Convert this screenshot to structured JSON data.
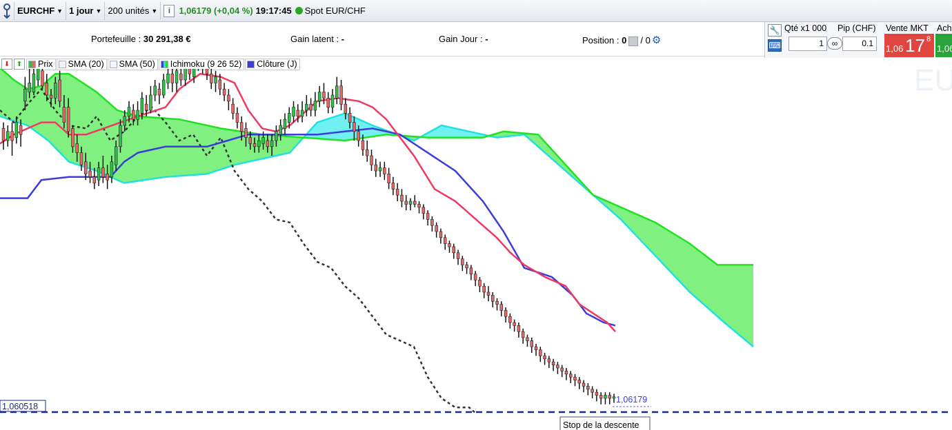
{
  "toolbar": {
    "symbol": "EURCHF",
    "timeframe": "1 jour",
    "units": "200 unités",
    "info_icon": "i",
    "price_change": "1,06179 (+0,04 %)",
    "time": "19:17:45",
    "instrument": "Spot EUR/CHF"
  },
  "infobar": {
    "portfolio_label": "Portefeuille :",
    "portfolio_value": "30 291,38 €",
    "unrealized_label": "Gain latent :",
    "unrealized_value": "-",
    "daily_label": "Gain Jour :",
    "daily_value": "-",
    "position_label": "Position :",
    "position_value": "0",
    "position_sep": "/ 0"
  },
  "trade_panel": {
    "qty_label": "Qté x1 000",
    "pip_label": "Pip (CHF)",
    "qty_value": "1",
    "pip_value": "0.1",
    "sell_label": "Vente MKT",
    "buy_label": "Ach",
    "sell_small": "1,06",
    "sell_big": "17",
    "sell_sup": "8",
    "buy_small": "1,06"
  },
  "legend": {
    "prix": "Prix",
    "sma20": "SMA (20)",
    "sma50": "SMA (50)",
    "ichimoku": "Ichimoku (9 26 52)",
    "cloture": "Clôture (J)"
  },
  "watermark": "EU",
  "colors": {
    "up_candle": "#2fc24a",
    "down_candle": "#e06a6a",
    "tenkan": "#ee3a63",
    "kijun": "#3c3cdc",
    "senkou_a": "#22e022",
    "senkou_b": "#22e0e0",
    "cloud_bull": "#80f080",
    "cloud_bear": "#70f0f0",
    "chikou": "#333333",
    "stop_line": "#1a2a8c"
  },
  "chart_data": {
    "type": "candlestick-ichimoku",
    "last_price": "1,06179",
    "level_price": "1,060518",
    "annotation": "Stop de la descente",
    "candles": [
      [
        0.94,
        0.9,
        0.96,
        0.87
      ],
      [
        0.9,
        0.93,
        0.95,
        0.88
      ],
      [
        0.93,
        0.9,
        0.96,
        0.85
      ],
      [
        0.91,
        0.96,
        0.98,
        0.89
      ],
      [
        0.95,
        0.92,
        0.97,
        0.88
      ],
      [
        1.03,
        1.07,
        1.11,
        1.0
      ],
      [
        1.06,
        1.09,
        1.14,
        1.04
      ],
      [
        1.06,
        1.12,
        1.15,
        1.05
      ],
      [
        1.1,
        1.14,
        1.18,
        1.08
      ],
      [
        1.13,
        1.08,
        1.16,
        1.07
      ],
      [
        1.09,
        1.05,
        1.12,
        1.03
      ],
      [
        1.05,
        1.04,
        1.07,
        1.01
      ],
      [
        1.04,
        1.09,
        1.11,
        1.02
      ],
      [
        1.1,
        1.03,
        1.13,
        1.01
      ],
      [
        1.01,
        0.96,
        1.05,
        0.94
      ],
      [
        1.01,
        0.93,
        1.04,
        0.91
      ],
      [
        0.94,
        0.88,
        0.95,
        0.86
      ],
      [
        0.89,
        0.86,
        0.92,
        0.83
      ],
      [
        0.86,
        0.82,
        0.88,
        0.8
      ],
      [
        0.83,
        0.79,
        0.86,
        0.77
      ],
      [
        0.8,
        0.78,
        0.83,
        0.76
      ],
      [
        0.78,
        0.76,
        0.81,
        0.74
      ],
      [
        0.77,
        0.81,
        0.83,
        0.75
      ],
      [
        0.81,
        0.78,
        0.85,
        0.76
      ],
      [
        0.79,
        0.77,
        0.82,
        0.74
      ],
      [
        0.78,
        0.83,
        0.85,
        0.76
      ],
      [
        0.82,
        0.88,
        0.9,
        0.8
      ],
      [
        0.88,
        0.95,
        0.97,
        0.86
      ],
      [
        0.95,
        0.98,
        1.0,
        0.93
      ],
      [
        0.98,
        1.01,
        1.03,
        0.96
      ],
      [
        1.0,
        0.97,
        1.02,
        0.95
      ],
      [
        0.97,
        1.0,
        1.03,
        0.95
      ],
      [
        0.99,
        1.04,
        1.06,
        0.97
      ],
      [
        1.02,
        1.0,
        1.05,
        0.98
      ],
      [
        1.0,
        1.05,
        1.08,
        0.99
      ],
      [
        1.05,
        1.08,
        1.1,
        1.03
      ],
      [
        1.07,
        1.05,
        1.09,
        1.02
      ],
      [
        1.05,
        1.1,
        1.12,
        1.04
      ],
      [
        1.09,
        1.12,
        1.15,
        1.07
      ],
      [
        1.12,
        1.09,
        1.14,
        1.06
      ],
      [
        1.09,
        1.13,
        1.15,
        1.06
      ],
      [
        1.12,
        1.1,
        1.14,
        1.08
      ],
      [
        1.1,
        1.15,
        1.17,
        1.08
      ],
      [
        1.14,
        1.12,
        1.16,
        1.1
      ],
      [
        1.11,
        1.16,
        1.18,
        1.09
      ],
      [
        1.15,
        1.18,
        1.2,
        1.13
      ],
      [
        1.17,
        1.14,
        1.19,
        1.12
      ],
      [
        1.14,
        1.12,
        1.16,
        1.1
      ],
      [
        1.12,
        1.09,
        1.14,
        1.07
      ],
      [
        1.09,
        1.11,
        1.13,
        1.06
      ],
      [
        1.1,
        1.07,
        1.12,
        1.05
      ],
      [
        1.07,
        1.05,
        1.09,
        1.03
      ],
      [
        1.05,
        1.03,
        1.07,
        1.0
      ],
      [
        1.02,
        0.99,
        1.04,
        0.97
      ],
      [
        0.99,
        0.96,
        1.01,
        0.94
      ],
      [
        0.96,
        0.93,
        0.98,
        0.9
      ],
      [
        0.94,
        0.91,
        0.96,
        0.88
      ],
      [
        0.91,
        0.89,
        0.93,
        0.87
      ],
      [
        0.89,
        0.88,
        0.91,
        0.86
      ],
      [
        0.88,
        0.9,
        0.92,
        0.86
      ],
      [
        0.89,
        0.91,
        0.93,
        0.87
      ],
      [
        0.9,
        0.88,
        0.92,
        0.86
      ],
      [
        0.88,
        0.9,
        0.92,
        0.85
      ],
      [
        0.9,
        0.93,
        0.95,
        0.88
      ],
      [
        0.92,
        0.95,
        0.97,
        0.9
      ],
      [
        0.94,
        0.97,
        0.99,
        0.92
      ],
      [
        0.96,
        0.99,
        1.01,
        0.94
      ],
      [
        0.98,
        1.01,
        1.03,
        0.96
      ],
      [
        1.0,
        0.98,
        1.02,
        0.96
      ],
      [
        0.98,
        1.0,
        1.03,
        0.96
      ],
      [
        1.0,
        1.02,
        1.05,
        0.98
      ],
      [
        1.02,
        1.0,
        1.04,
        0.98
      ],
      [
        1.0,
        1.03,
        1.06,
        0.98
      ],
      [
        1.03,
        1.06,
        1.08,
        1.01
      ],
      [
        1.06,
        1.04,
        1.09,
        1.02
      ],
      [
        1.04,
        1.01,
        1.06,
        0.99
      ],
      [
        1.01,
        1.05,
        1.07,
        0.99
      ],
      [
        1.04,
        1.08,
        1.11,
        1.02
      ],
      [
        1.08,
        1.02,
        1.1,
        1.0
      ],
      [
        1.02,
        0.99,
        1.04,
        0.97
      ],
      [
        0.99,
        0.96,
        1.01,
        0.94
      ],
      [
        0.96,
        0.93,
        0.98,
        0.9
      ],
      [
        0.93,
        0.9,
        0.95,
        0.88
      ],
      [
        0.9,
        0.87,
        0.92,
        0.85
      ],
      [
        0.87,
        0.85,
        0.9,
        0.83
      ],
      [
        0.85,
        0.82,
        0.87,
        0.8
      ],
      [
        0.82,
        0.8,
        0.84,
        0.78
      ],
      [
        0.8,
        0.81,
        0.83,
        0.78
      ],
      [
        0.81,
        0.79,
        0.83,
        0.77
      ],
      [
        0.79,
        0.76,
        0.81,
        0.74
      ],
      [
        0.76,
        0.74,
        0.78,
        0.72
      ],
      [
        0.74,
        0.72,
        0.76,
        0.7
      ],
      [
        0.72,
        0.7,
        0.74,
        0.68
      ],
      [
        0.7,
        0.69,
        0.72,
        0.67
      ],
      [
        0.69,
        0.7,
        0.71,
        0.67
      ],
      [
        0.7,
        0.69,
        0.72,
        0.68
      ],
      [
        0.69,
        0.68,
        0.7,
        0.66
      ],
      [
        0.68,
        0.66,
        0.69,
        0.64
      ],
      [
        0.66,
        0.64,
        0.67,
        0.62
      ],
      [
        0.64,
        0.62,
        0.65,
        0.6
      ],
      [
        0.62,
        0.6,
        0.63,
        0.58
      ],
      [
        0.6,
        0.58,
        0.61,
        0.56
      ],
      [
        0.58,
        0.56,
        0.59,
        0.54
      ],
      [
        0.56,
        0.55,
        0.57,
        0.53
      ],
      [
        0.55,
        0.53,
        0.56,
        0.51
      ],
      [
        0.53,
        0.51,
        0.54,
        0.49
      ],
      [
        0.51,
        0.49,
        0.52,
        0.47
      ],
      [
        0.49,
        0.48,
        0.5,
        0.46
      ],
      [
        0.48,
        0.46,
        0.49,
        0.44
      ],
      [
        0.46,
        0.44,
        0.47,
        0.42
      ],
      [
        0.44,
        0.42,
        0.45,
        0.4
      ],
      [
        0.42,
        0.4,
        0.43,
        0.38
      ],
      [
        0.4,
        0.39,
        0.42,
        0.37
      ],
      [
        0.39,
        0.37,
        0.4,
        0.35
      ],
      [
        0.37,
        0.36,
        0.38,
        0.34
      ],
      [
        0.36,
        0.34,
        0.37,
        0.32
      ],
      [
        0.34,
        0.32,
        0.35,
        0.3
      ],
      [
        0.32,
        0.3,
        0.33,
        0.28
      ],
      [
        0.3,
        0.29,
        0.31,
        0.27
      ],
      [
        0.29,
        0.27,
        0.3,
        0.25
      ],
      [
        0.27,
        0.25,
        0.28,
        0.23
      ],
      [
        0.25,
        0.24,
        0.26,
        0.22
      ],
      [
        0.24,
        0.22,
        0.25,
        0.2
      ],
      [
        0.22,
        0.21,
        0.23,
        0.19
      ],
      [
        0.21,
        0.19,
        0.22,
        0.17
      ],
      [
        0.19,
        0.18,
        0.2,
        0.16
      ],
      [
        0.18,
        0.17,
        0.19,
        0.15
      ],
      [
        0.17,
        0.16,
        0.18,
        0.14
      ],
      [
        0.16,
        0.15,
        0.17,
        0.13
      ],
      [
        0.15,
        0.14,
        0.16,
        0.12
      ],
      [
        0.14,
        0.13,
        0.15,
        0.11
      ],
      [
        0.13,
        0.12,
        0.14,
        0.1
      ],
      [
        0.12,
        0.11,
        0.13,
        0.09
      ],
      [
        0.11,
        0.1,
        0.12,
        0.08
      ],
      [
        0.1,
        0.09,
        0.11,
        0.07
      ],
      [
        0.09,
        0.08,
        0.1,
        0.06
      ],
      [
        0.08,
        0.07,
        0.09,
        0.05
      ],
      [
        0.07,
        0.06,
        0.08,
        0.04
      ],
      [
        0.06,
        0.05,
        0.07,
        0.03
      ],
      [
        0.05,
        0.06,
        0.07,
        0.03
      ],
      [
        0.06,
        0.05,
        0.07,
        0.03
      ],
      [
        0.05,
        0.055,
        0.065,
        0.035
      ]
    ],
    "tenkan": [
      [
        0,
        0.89
      ],
      [
        20,
        0.92
      ],
      [
        40,
        0.94
      ],
      [
        60,
        0.96
      ],
      [
        80,
        0.96
      ],
      [
        100,
        0.92
      ],
      [
        125,
        0.92
      ],
      [
        150,
        0.94
      ],
      [
        175,
        0.96
      ],
      [
        200,
        0.98
      ],
      [
        240,
        1.01
      ],
      [
        260,
        1.07
      ],
      [
        290,
        1.12
      ],
      [
        320,
        1.11
      ],
      [
        340,
        1.09
      ],
      [
        360,
        1.0
      ],
      [
        380,
        0.94
      ],
      [
        400,
        0.93
      ],
      [
        420,
        0.95
      ],
      [
        440,
        0.99
      ],
      [
        460,
        1.03
      ],
      [
        490,
        1.04
      ],
      [
        520,
        1.03
      ],
      [
        540,
        1.01
      ],
      [
        560,
        0.97
      ],
      [
        600,
        0.85
      ],
      [
        630,
        0.74
      ],
      [
        660,
        0.7
      ],
      [
        690,
        0.64
      ],
      [
        720,
        0.58
      ],
      [
        740,
        0.53
      ],
      [
        760,
        0.49
      ],
      [
        790,
        0.45
      ],
      [
        820,
        0.42
      ],
      [
        840,
        0.36
      ],
      [
        860,
        0.33
      ],
      [
        880,
        0.3
      ],
      [
        892,
        0.27
      ]
    ],
    "kijun": [
      [
        0,
        0.71
      ],
      [
        40,
        0.71
      ],
      [
        60,
        0.77
      ],
      [
        100,
        0.78
      ],
      [
        160,
        0.78
      ],
      [
        180,
        0.83
      ],
      [
        200,
        0.86
      ],
      [
        240,
        0.88
      ],
      [
        300,
        0.88
      ],
      [
        330,
        0.9
      ],
      [
        360,
        0.92
      ],
      [
        420,
        0.92
      ],
      [
        460,
        0.92
      ],
      [
        500,
        0.93
      ],
      [
        540,
        0.94
      ],
      [
        580,
        0.92
      ],
      [
        620,
        0.86
      ],
      [
        660,
        0.8
      ],
      [
        700,
        0.7
      ],
      [
        730,
        0.6
      ],
      [
        760,
        0.48
      ],
      [
        800,
        0.45
      ],
      [
        830,
        0.39
      ],
      [
        850,
        0.33
      ],
      [
        875,
        0.3
      ],
      [
        892,
        0.29
      ]
    ],
    "chikou": [
      [
        0,
        1.0
      ],
      [
        20,
        0.96
      ],
      [
        40,
        1.02
      ],
      [
        60,
        1.07
      ],
      [
        80,
        1.0
      ],
      [
        100,
        0.95
      ],
      [
        125,
        0.94
      ],
      [
        140,
        0.98
      ],
      [
        160,
        0.9
      ],
      [
        180,
        0.93
      ],
      [
        200,
        0.98
      ],
      [
        220,
        1.01
      ],
      [
        240,
        0.96
      ],
      [
        260,
        0.9
      ],
      [
        280,
        0.92
      ],
      [
        300,
        0.85
      ],
      [
        320,
        0.91
      ],
      [
        340,
        0.8
      ],
      [
        360,
        0.74
      ],
      [
        380,
        0.7
      ],
      [
        400,
        0.64
      ],
      [
        420,
        0.63
      ],
      [
        440,
        0.56
      ],
      [
        460,
        0.5
      ],
      [
        480,
        0.48
      ],
      [
        500,
        0.42
      ],
      [
        520,
        0.38
      ],
      [
        540,
        0.32
      ],
      [
        560,
        0.26
      ],
      [
        580,
        0.24
      ],
      [
        600,
        0.22
      ],
      [
        620,
        0.12
      ],
      [
        640,
        0.05
      ],
      [
        660,
        0.02
      ],
      [
        680,
        0.02
      ],
      [
        690,
        0.0
      ]
    ],
    "senkou_a": [
      [
        0,
        1.14
      ],
      [
        20,
        1.1
      ],
      [
        40,
        1.07
      ],
      [
        60,
        1.08
      ],
      [
        80,
        1.12
      ],
      [
        100,
        1.12
      ],
      [
        140,
        1.06
      ],
      [
        170,
        1.0
      ],
      [
        200,
        0.98
      ],
      [
        260,
        0.97
      ],
      [
        320,
        0.94
      ],
      [
        380,
        0.92
      ],
      [
        440,
        0.91
      ],
      [
        500,
        0.9
      ],
      [
        560,
        0.92
      ],
      [
        620,
        0.91
      ],
      [
        700,
        0.91
      ],
      [
        730,
        0.93
      ],
      [
        780,
        0.92
      ],
      [
        820,
        0.82
      ],
      [
        860,
        0.72
      ],
      [
        900,
        0.68
      ],
      [
        950,
        0.63
      ],
      [
        1000,
        0.56
      ],
      [
        1040,
        0.49
      ],
      [
        1092,
        0.49
      ]
    ],
    "senkou_b": [
      [
        0,
        0.98
      ],
      [
        40,
        0.95
      ],
      [
        70,
        0.9
      ],
      [
        100,
        0.83
      ],
      [
        140,
        0.8
      ],
      [
        180,
        0.76
      ],
      [
        240,
        0.78
      ],
      [
        300,
        0.79
      ],
      [
        340,
        0.82
      ],
      [
        380,
        0.84
      ],
      [
        420,
        0.86
      ],
      [
        460,
        0.96
      ],
      [
        500,
        0.99
      ],
      [
        540,
        0.95
      ],
      [
        600,
        0.9
      ],
      [
        640,
        0.95
      ],
      [
        680,
        0.93
      ],
      [
        720,
        0.91
      ],
      [
        760,
        0.92
      ],
      [
        800,
        0.84
      ],
      [
        850,
        0.74
      ],
      [
        900,
        0.64
      ],
      [
        950,
        0.52
      ],
      [
        1000,
        0.4
      ],
      [
        1050,
        0.3
      ],
      [
        1092,
        0.22
      ]
    ]
  }
}
